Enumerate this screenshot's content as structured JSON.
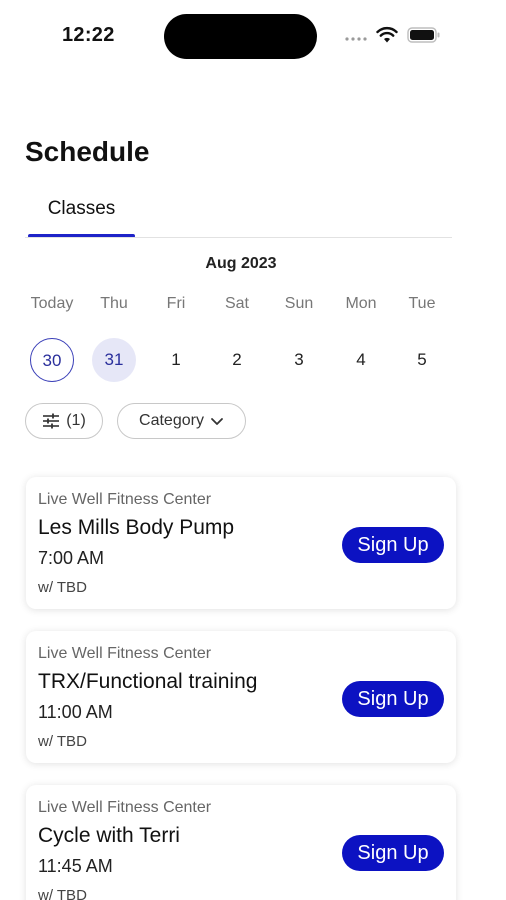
{
  "status_bar": {
    "time": "12:22",
    "signal_icon": "signal-dots-icon",
    "wifi_icon": "wifi-icon",
    "battery_icon": "battery-icon"
  },
  "header": {
    "title": "Schedule"
  },
  "tabs": [
    {
      "label": "Classes",
      "active": true
    }
  ],
  "calendar": {
    "month": "Aug 2023",
    "days": [
      {
        "name": "Today",
        "number": "30",
        "state": "today"
      },
      {
        "name": "Thu",
        "number": "31",
        "state": "selected"
      },
      {
        "name": "Fri",
        "number": "1",
        "state": ""
      },
      {
        "name": "Sat",
        "number": "2",
        "state": ""
      },
      {
        "name": "Sun",
        "number": "3",
        "state": ""
      },
      {
        "name": "Mon",
        "number": "4",
        "state": ""
      },
      {
        "name": "Tue",
        "number": "5",
        "state": ""
      }
    ]
  },
  "filters": {
    "filter_label": "(1)",
    "filter_icon": "sliders-icon",
    "category_label": "Category",
    "category_icon": "chevron-down-icon"
  },
  "classes": [
    {
      "location": "Live Well Fitness Center",
      "title": "Les Mills Body Pump",
      "time": "7:00 AM",
      "instructor": "w/ TBD",
      "button": "Sign Up"
    },
    {
      "location": "Live Well Fitness Center",
      "title": "TRX/Functional training",
      "time": "11:00 AM",
      "instructor": "w/ TBD",
      "button": "Sign Up"
    },
    {
      "location": "Live Well Fitness Center",
      "title": "Cycle with Terri",
      "time": "11:45 AM",
      "instructor": "w/ TBD",
      "button": "Sign Up"
    }
  ],
  "colors": {
    "accent": "#0c12c2",
    "tab_underline": "#1e23c8",
    "selected_day_bg": "#e6e7f7"
  }
}
